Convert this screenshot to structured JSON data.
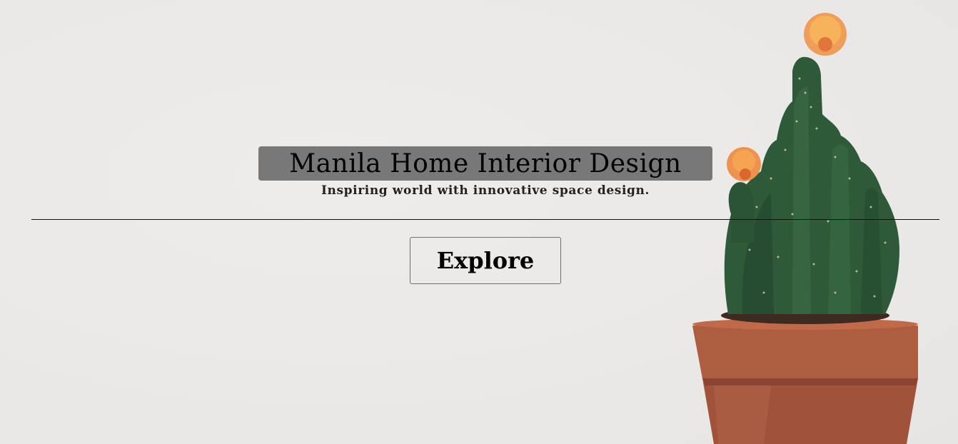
{
  "hero": {
    "title": "Manila Home Interior Design",
    "subtitle": "Inspiring world with innovative space design.",
    "cta_label": "Explore",
    "image": "potted-cactus-with-orange-flowers"
  },
  "colors": {
    "background": "#ebe9e7",
    "title_box": "#646464",
    "text": "#000000",
    "pot": "#a0533a",
    "cactus": "#2f5a3a",
    "flower": "#f0964a"
  }
}
